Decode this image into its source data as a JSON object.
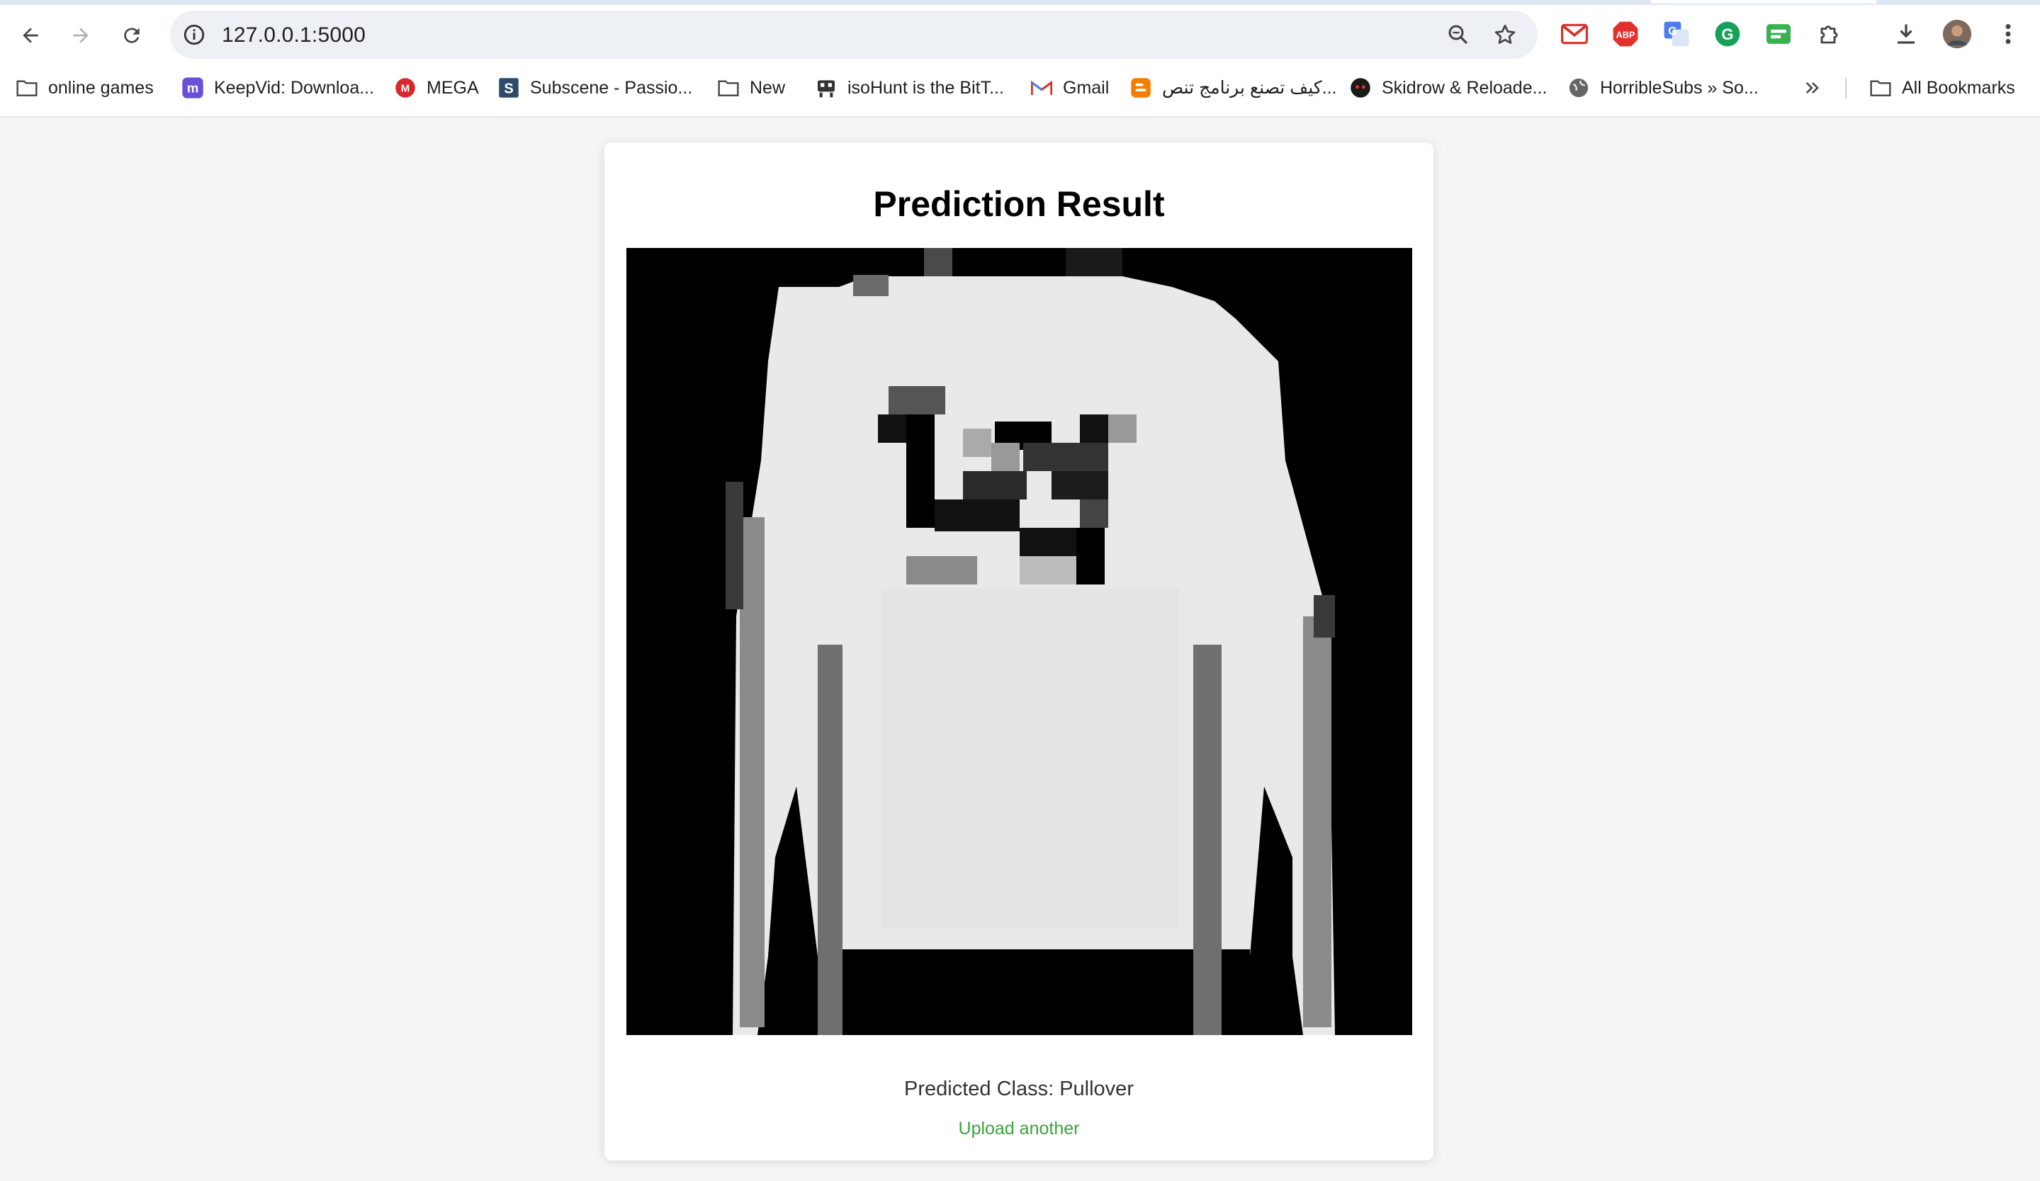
{
  "browser": {
    "url": "127.0.0.1:5000",
    "bookmarks": [
      {
        "label": "online games",
        "icon": "folder-icon"
      },
      {
        "label": "KeepVid: Downloa...",
        "icon": "keepvid-icon"
      },
      {
        "label": "MEGA",
        "icon": "mega-icon"
      },
      {
        "label": "Subscene - Passio...",
        "icon": "subscene-icon"
      },
      {
        "label": "New",
        "icon": "folder-icon"
      },
      {
        "label": "isoHunt is the BitT...",
        "icon": "isohunt-icon"
      },
      {
        "label": "Gmail",
        "icon": "gmail-icon"
      },
      {
        "label": "كيف تصنع برنامج تنص...",
        "icon": "blogger-icon"
      },
      {
        "label": "Skidrow & Reloade...",
        "icon": "skidrow-icon"
      },
      {
        "label": "HorribleSubs » So...",
        "icon": "globe-icon"
      }
    ],
    "all_bookmarks_label": "All Bookmarks",
    "extensions": [
      "gmail-extension-icon",
      "adblock-plus-icon",
      "google-translate-icon",
      "grammarly-icon",
      "green-extension-icon",
      "puzzle-extensions-icon"
    ],
    "colors": {
      "gmail": "#d93025",
      "abp": "#e2312b",
      "translate": "#4a7ef0",
      "grammarly": "#15a15a",
      "green_ext": "#37b24d"
    }
  },
  "page": {
    "title": "Prediction Result",
    "predicted_label": "Predicted Class: Pullover",
    "upload_link": "Upload another",
    "link_color": "#3aa33a",
    "image_alt": "28x28 grayscale input image of a pullover"
  }
}
